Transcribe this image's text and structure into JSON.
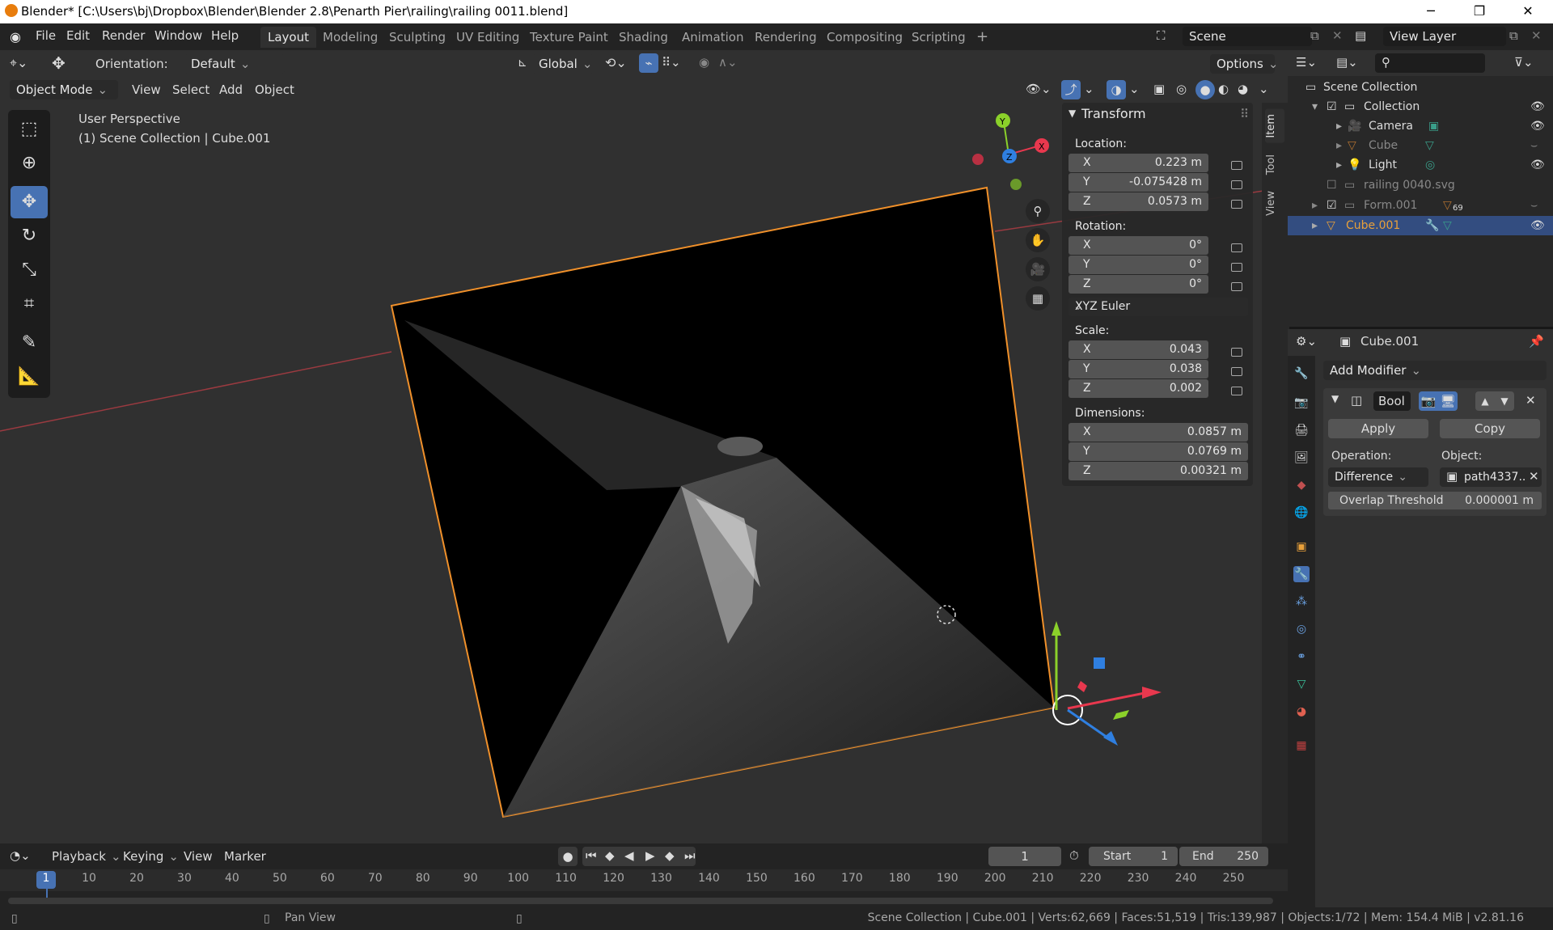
{
  "window": {
    "title": "Blender* [C:\\Users\\bj\\Dropbox\\Blender\\Blender 2.8\\Penarth Pier\\railing\\railing 0011.blend]",
    "min_icon": "minimize-icon",
    "max_icon": "maximize-icon",
    "close_icon": "close-icon"
  },
  "menubar": {
    "items": [
      "File",
      "Edit",
      "Render",
      "Window",
      "Help"
    ],
    "workspaces": [
      "Layout",
      "Modeling",
      "Sculpting",
      "UV Editing",
      "Texture Paint",
      "Shading",
      "Animation",
      "Rendering",
      "Compositing",
      "Scripting"
    ],
    "active_workspace": "Layout",
    "add_tab": "+",
    "scene_label": "Scene",
    "view_layer_label": "View Layer"
  },
  "viewport_header": {
    "orientation_label": "Orientation:",
    "orientation_value": "Default",
    "transform_orientation": "Global",
    "options_label": "Options",
    "mode": "Object Mode",
    "menus": [
      "View",
      "Select",
      "Add",
      "Object"
    ]
  },
  "viewport": {
    "perspective": "User Perspective",
    "context": "(1) Scene Collection | Cube.001",
    "gizmo_x": "X",
    "gizmo_y": "Y",
    "gizmo_z": "Z"
  },
  "npanel": {
    "title": "Transform",
    "location_label": "Location:",
    "location": [
      {
        "axis": "X",
        "value": "0.223 m"
      },
      {
        "axis": "Y",
        "value": "-0.075428 m"
      },
      {
        "axis": "Z",
        "value": "0.0573 m"
      }
    ],
    "rotation_label": "Rotation:",
    "rotation": [
      {
        "axis": "X",
        "value": "0°"
      },
      {
        "axis": "Y",
        "value": "0°"
      },
      {
        "axis": "Z",
        "value": "0°"
      }
    ],
    "rotation_mode": "XYZ Euler",
    "scale_label": "Scale:",
    "scale": [
      {
        "axis": "X",
        "value": "0.043"
      },
      {
        "axis": "Y",
        "value": "0.038"
      },
      {
        "axis": "Z",
        "value": "0.002"
      }
    ],
    "dimensions_label": "Dimensions:",
    "dimensions": [
      {
        "axis": "X",
        "value": "0.0857 m"
      },
      {
        "axis": "Y",
        "value": "0.0769 m"
      },
      {
        "axis": "Z",
        "value": "0.00321 m"
      }
    ],
    "tabs": [
      "Item",
      "Tool",
      "View"
    ]
  },
  "outliner": {
    "rows": [
      {
        "label": "Scene Collection"
      },
      {
        "label": "Collection"
      },
      {
        "label": "Camera"
      },
      {
        "label": "Cube"
      },
      {
        "label": "Light"
      },
      {
        "label": "railing 0040.svg"
      },
      {
        "label": "Form.001",
        "badge": "69"
      },
      {
        "label": "Cube.001"
      }
    ]
  },
  "properties": {
    "object_name": "Cube.001",
    "add_modifier": "Add Modifier",
    "modifier_name": "Bool",
    "apply": "Apply",
    "copy": "Copy",
    "operation_label": "Operation:",
    "operation_value": "Difference",
    "object_label": "Object:",
    "object_value": "path4337..",
    "overlap_label": "Overlap Threshold",
    "overlap_value": "0.000001 m"
  },
  "timeline": {
    "menus": [
      "Playback",
      "Keying",
      "View",
      "Marker"
    ],
    "current_frame": "1",
    "start_label": "Start",
    "start_value": "1",
    "end_label": "End",
    "end_value": "250",
    "ticks": [
      "1",
      "10",
      "20",
      "30",
      "40",
      "50",
      "60",
      "70",
      "80",
      "90",
      "100",
      "110",
      "120",
      "130",
      "140",
      "150",
      "160",
      "170",
      "180",
      "190",
      "200",
      "210",
      "220",
      "230",
      "240",
      "250"
    ]
  },
  "statusbar": {
    "pan_view": "Pan View",
    "stats": "Scene Collection | Cube.001 | Verts:62,669 | Faces:51,519 | Tris:139,987 | Objects:1/72 | Mem: 154.4 MiB | v2.81.16"
  },
  "colors": {
    "accent": "#4772b3",
    "selection": "#e8a03a",
    "selected_text": "#e8a03a"
  }
}
